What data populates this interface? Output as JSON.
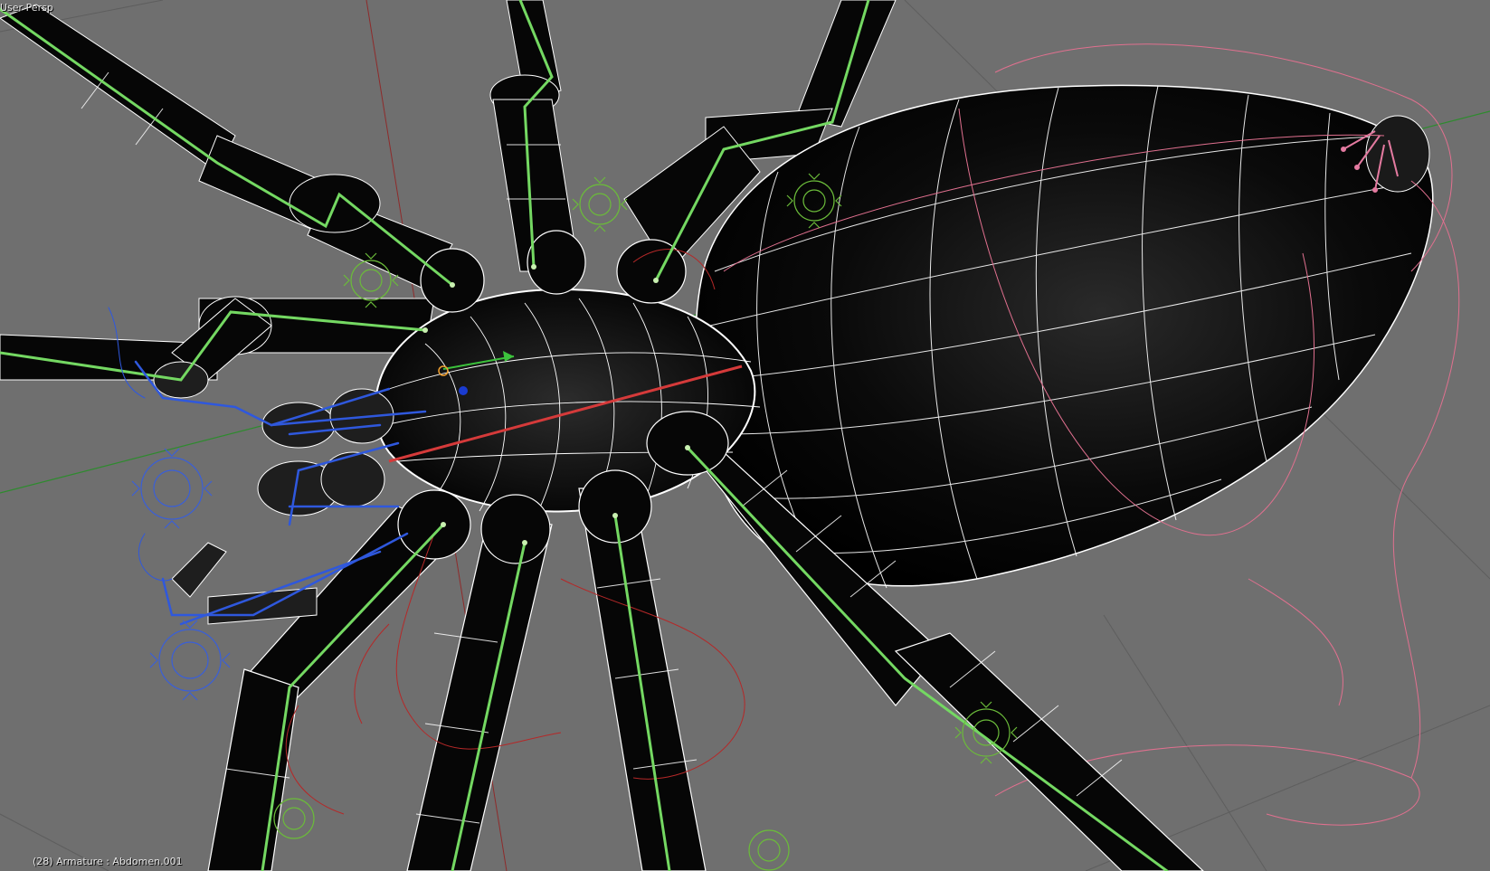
{
  "viewport": {
    "view_label": "User Persp",
    "object_info": "(28) Armature : Abdomen.001"
  },
  "colors": {
    "background": "#6f6f6f",
    "mesh_fill": "#050505",
    "wireframe": "#ffffff",
    "bone_green": "#6fd85a",
    "bone_blue": "#2f55d8",
    "curve_red": "#c82a2a",
    "curve_pink": "#e0708f",
    "axis_green": "#2e8b2e"
  }
}
